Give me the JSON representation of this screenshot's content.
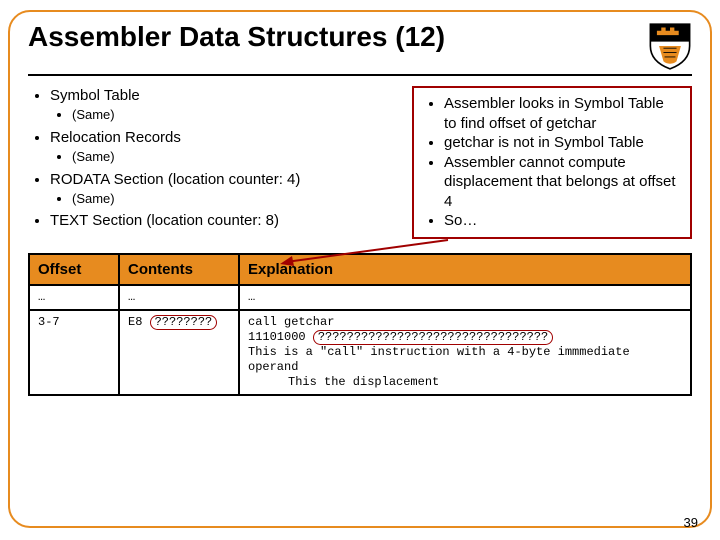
{
  "title": "Assembler Data Structures (12)",
  "page_number": "39",
  "left": {
    "items": [
      {
        "label": "Symbol Table",
        "sub": "(Same)"
      },
      {
        "label": "Relocation Records",
        "sub": "(Same)"
      },
      {
        "label": "RODATA Section (location counter: 4)",
        "sub": "(Same)"
      },
      {
        "label": "TEXT Section (location counter: 8)",
        "sub": ""
      }
    ]
  },
  "callout": {
    "lines": [
      "Assembler looks in Symbol Table to find offset of getchar",
      "getchar is not in Symbol Table",
      "Assembler cannot compute displacement that belongs at offset 4",
      "So…"
    ]
  },
  "table": {
    "headers": {
      "offset": "Offset",
      "contents": "Contents",
      "explanation": "Explanation"
    },
    "rows": [
      {
        "offset": "…",
        "contents_plain": "…",
        "explanation_plain": "…"
      },
      {
        "offset": "3-7",
        "contents_prefix": "E8 ",
        "contents_q": "????????",
        "expl_l1": "call getchar",
        "expl_l2a": "11101000 ",
        "expl_l2b": "????????????????????????????????",
        "expl_l3": "This is a \"call\" instruction with a 4-byte immmediate operand",
        "expl_l4": "This the displacement"
      }
    ]
  }
}
